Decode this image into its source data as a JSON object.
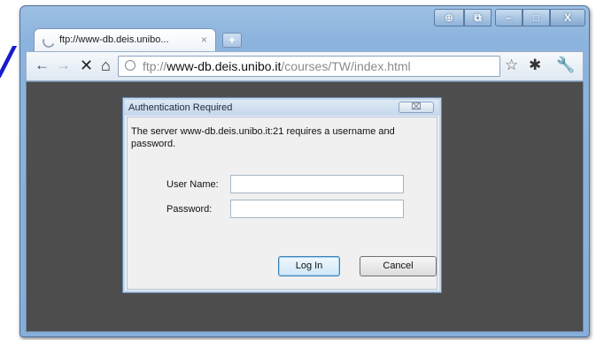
{
  "tab": {
    "title": "ftp://www-db.deis.unibo...",
    "close": "×"
  },
  "new_tab": "+",
  "toolbar": {
    "back": "←",
    "forward": "→",
    "stop": "✕",
    "home": "⌂",
    "url_scheme": "ftp://",
    "url_host": "www-db.deis.unibo.it",
    "url_path": "/courses/TW/index.html",
    "star": "☆",
    "page": "✱",
    "wrench": "🔧"
  },
  "window_controls": {
    "a": "⊕",
    "b": "⧉",
    "minimize": "–",
    "maximize": "□",
    "close": "X"
  },
  "dialog": {
    "title": "Authentication Required",
    "close": "⌧",
    "message": "The server www-db.deis.unibo.it:21 requires a username and password.",
    "username_label": "User Name:",
    "username_value": "",
    "password_label": "Password:",
    "password_value": "",
    "login_button": "Log In",
    "cancel_button": "Cancel"
  },
  "slide_glyph": "/",
  "colors": {
    "page_background": "#4d4d4d",
    "window_frame": "#8cb3dd",
    "dialog_background": "#f0f0f0"
  },
  "icons": [
    "spinner-icon",
    "back-icon",
    "forward-icon",
    "stop-icon",
    "home-icon",
    "page-info-icon",
    "star-icon",
    "page-menu-icon",
    "wrench-icon"
  ]
}
